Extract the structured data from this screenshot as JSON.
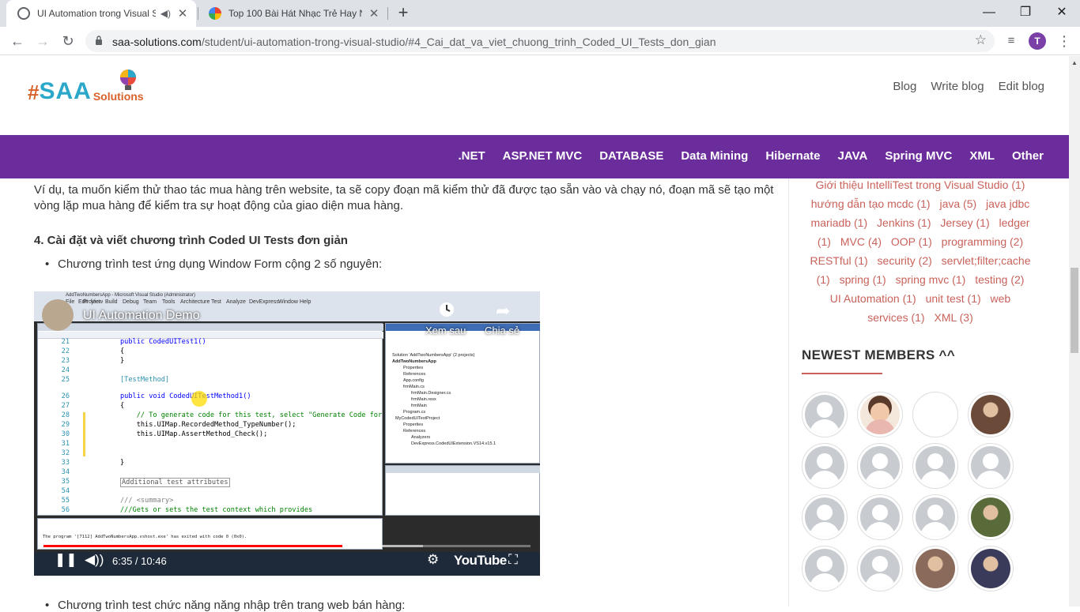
{
  "browser": {
    "tabs": [
      {
        "title": "UI Automation trong Visual S",
        "active": true,
        "audio": true
      },
      {
        "title": "Top 100 Bài Hát Nhạc Trẻ Hay Nh",
        "active": false,
        "audio": false
      }
    ],
    "url_host": "saa-solutions.com",
    "url_path": "/student/ui-automation-trong-visual-studio/#4_Cai_dat_va_viet_chuong_trinh_Coded_UI_Tests_don_gian",
    "profile_initial": "T",
    "window_controls": {
      "minimize": "—",
      "maximize": "❐",
      "close": "✕"
    }
  },
  "site": {
    "logo": {
      "hash": "#",
      "saa": "SAA",
      "solutions": "Solutions"
    },
    "top_nav": [
      "Blog",
      "Write blog",
      "Edit blog"
    ],
    "categories": [
      ".NET",
      "ASP.NET MVC",
      "DATABASE",
      "Data Mining",
      "Hibernate",
      "JAVA",
      "Spring MVC",
      "XML",
      "Other"
    ]
  },
  "article": {
    "paragraph": "Ví dụ, ta muốn kiểm thử thao tác mua hàng trên website, ta sẽ copy đoạn mã kiểm thử đã được tạo sẵn vào và chạy nó, đoạn mã sẽ tạo một vòng lặp mua hàng để kiểm tra sự hoạt động của giao diện mua hàng.",
    "heading": "4. Cài đặt và viết chương trình Coded UI Tests đơn giản",
    "bullet1": "Chương trình test ứng dụng Window Form cộng 2 số nguyên:",
    "bullet2": "Chương trình test chức năng năng nhập trên trang web bán hàng:"
  },
  "video": {
    "title": "UI Automation Demo",
    "watch_later": "Xem sau",
    "share": "Chia sẻ",
    "time": "6:35 / 10:46",
    "progress": 0.614,
    "buffered": 0.78,
    "brand": "YouTube",
    "vs_window_title": "AddTwoNumbersApp - Microsoft Visual Studio (Administrator)",
    "vs_menu": [
      "File",
      "Edit",
      "View",
      "Project",
      "Build",
      "Debug",
      "Team",
      "Tools",
      "Architecture",
      "Test",
      "Analyze",
      "DevExpress",
      "Window",
      "Help"
    ],
    "code_lines": [
      {
        "n": "21",
        "t": "public CodedUITest1()"
      },
      {
        "n": "22",
        "t": "{"
      },
      {
        "n": "23",
        "t": "}"
      },
      {
        "n": "24",
        "t": ""
      },
      {
        "n": "25",
        "t": "[TestMethod]"
      },
      {
        "n": "26",
        "t": "public void CodedUITestMethod1()"
      },
      {
        "n": "27",
        "t": "{"
      },
      {
        "n": "28",
        "t": "    // To generate code for this test, select \"Generate Code for"
      },
      {
        "n": "29",
        "t": "    this.UIMap.RecordedMethod_TypeNumber();"
      },
      {
        "n": "30",
        "t": "    this.UIMap.AssertMethod_Check();"
      },
      {
        "n": "31",
        "t": ""
      },
      {
        "n": "32",
        "t": ""
      },
      {
        "n": "33",
        "t": "}"
      },
      {
        "n": "34",
        "t": ""
      },
      {
        "n": "35",
        "t": "Additional test attributes"
      },
      {
        "n": "54",
        "t": ""
      },
      {
        "n": "55",
        "t": "/// <summary>"
      },
      {
        "n": "56",
        "t": "///Gets or sets the test context which provides"
      }
    ],
    "solution_explorer": [
      "Solution 'AddTwoNumbersApp' (2 projects)",
      "AddTwoNumbersApp",
      "Properties",
      "References",
      "App.config",
      "frmMain.cs",
      "frmMain.Designer.cs",
      "frmMain.resx",
      "frmMain",
      "Program.cs",
      "MyCodedUITestProject",
      "Properties",
      "References",
      "Analyzers",
      "DevExpress.CodedUIExtension.VS14.v15.1"
    ],
    "output_text": "The program '[7112] AddTwoNumbersApp.vshost.exe' has exited with code 0 (0x0)."
  },
  "sidebar": {
    "tags": [
      "Giới thiệu IntelliTest trong Visual Studio (1)",
      "hướng dẫn tạo mcdc (1)",
      "java (5)",
      "java jdbc",
      "mariadb (1)",
      "Jenkins (1)",
      "Jersey (1)",
      "ledger",
      "(1)",
      "MVC (4)",
      "OOP (1)",
      "programming (2)",
      "RESTful (1)",
      "security (2)",
      "servlet;filter;cache",
      "(1)",
      "spring (1)",
      "spring mvc (1)",
      "testing (2)",
      "UI Automation (1)",
      "unit test (1)",
      "web",
      "services (1)",
      "XML (3)"
    ],
    "newest_title": "NEWEST MEMBERS ^^",
    "members": [
      {
        "type": "default"
      },
      {
        "type": "cartoon"
      },
      {
        "type": "blank"
      },
      {
        "type": "photo"
      },
      {
        "type": "default"
      },
      {
        "type": "default"
      },
      {
        "type": "default"
      },
      {
        "type": "default"
      },
      {
        "type": "default"
      },
      {
        "type": "default"
      },
      {
        "type": "default"
      },
      {
        "type": "photo"
      },
      {
        "type": "default"
      },
      {
        "type": "default"
      },
      {
        "type": "photo"
      },
      {
        "type": "photo"
      }
    ]
  }
}
